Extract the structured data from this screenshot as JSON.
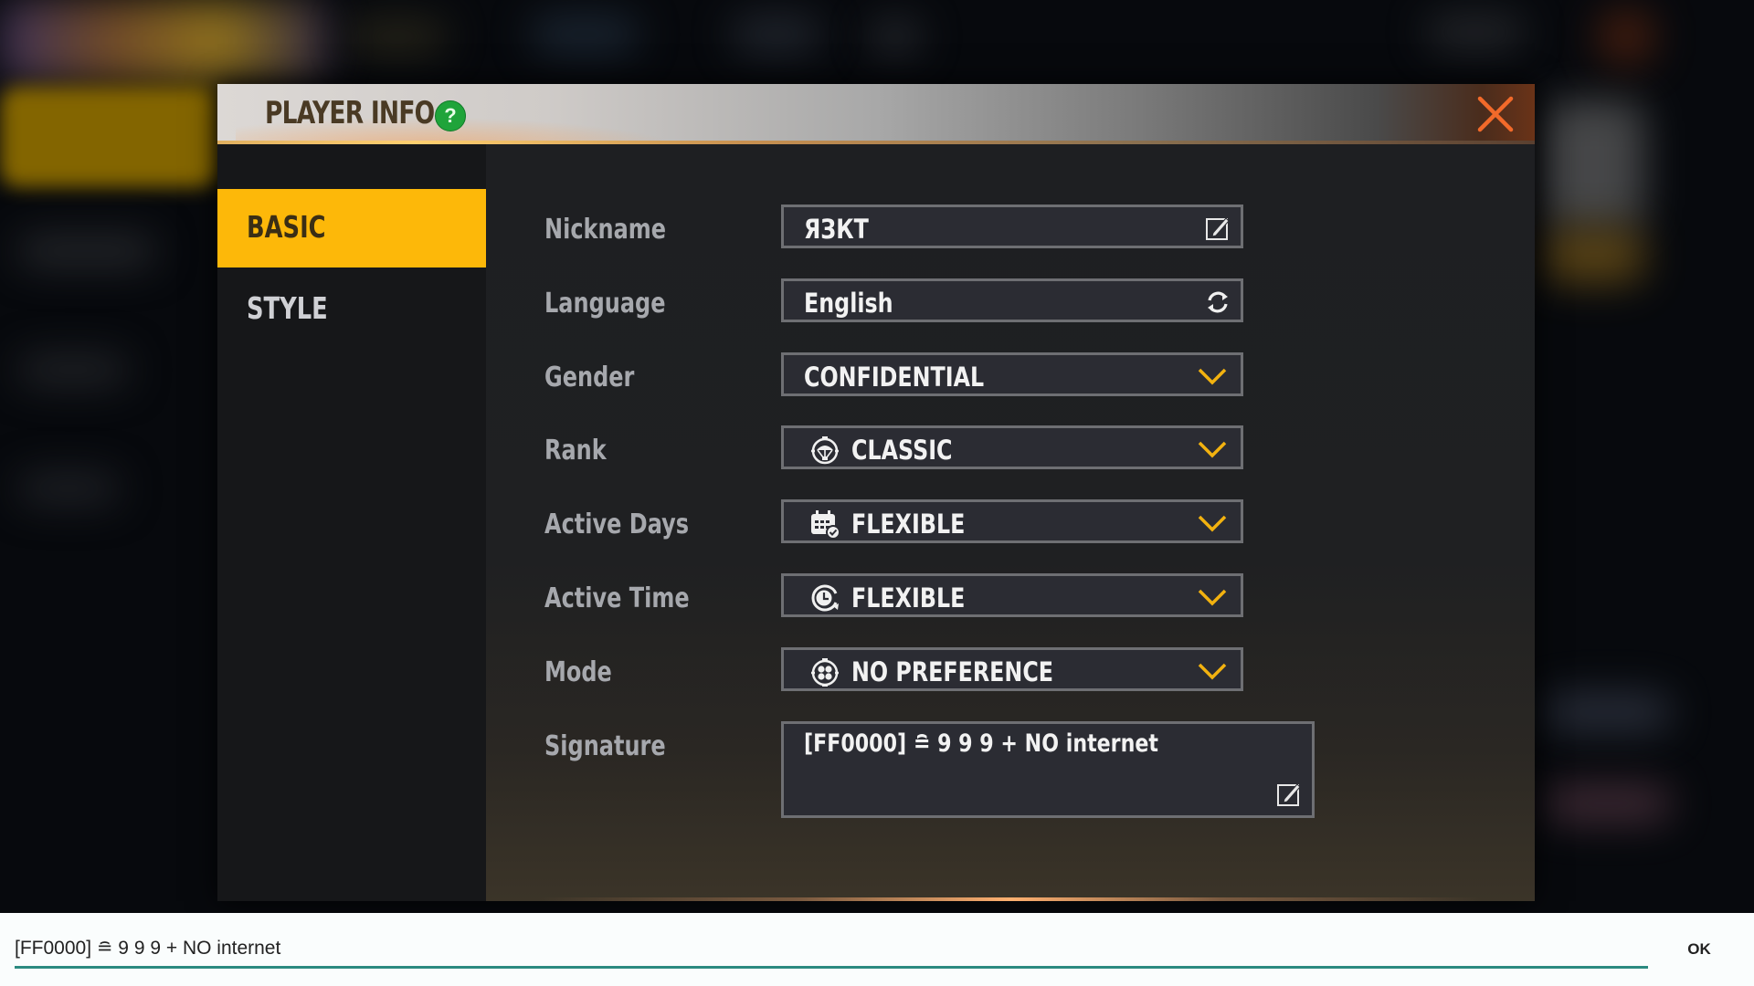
{
  "dialog": {
    "title": "PLAYER INFO",
    "help_label": "?",
    "close_icon": "close-x-icon",
    "accent_color": "#fdb809",
    "close_color": "#f26a2a"
  },
  "sidebar": {
    "tabs": [
      {
        "label": "BASIC",
        "active": true
      },
      {
        "label": "STYLE",
        "active": false
      }
    ]
  },
  "form": {
    "nickname": {
      "label": "Nickname",
      "value": "ЯЗКТ",
      "icon": "edit-icon"
    },
    "language": {
      "label": "Language",
      "value": "English",
      "icon": "refresh-icon"
    },
    "gender": {
      "label": "Gender",
      "value": "CONFIDENTIAL",
      "icon": "chevron-down-icon"
    },
    "rank": {
      "label": "Rank",
      "value": "CLASSIC",
      "lead_icon": "parachute-icon",
      "icon": "chevron-down-icon"
    },
    "active_days": {
      "label": "Active Days",
      "value": "FLEXIBLE",
      "lead_icon": "calendar-check-icon",
      "icon": "chevron-down-icon"
    },
    "active_time": {
      "label": "Active Time",
      "value": "FLEXIBLE",
      "lead_icon": "clock-icon",
      "icon": "chevron-down-icon"
    },
    "mode": {
      "label": "Mode",
      "value": "NO PREFERENCE",
      "lead_icon": "mode-grid-icon",
      "icon": "chevron-down-icon"
    },
    "signature": {
      "label": "Signature",
      "value": "[FF0000] ≘ 9 9 9 + NO internet",
      "icon": "edit-icon"
    }
  },
  "input_bar": {
    "value": "[FF0000] ≘ 9 9 9 + NO internet",
    "ok_label": "OK"
  }
}
